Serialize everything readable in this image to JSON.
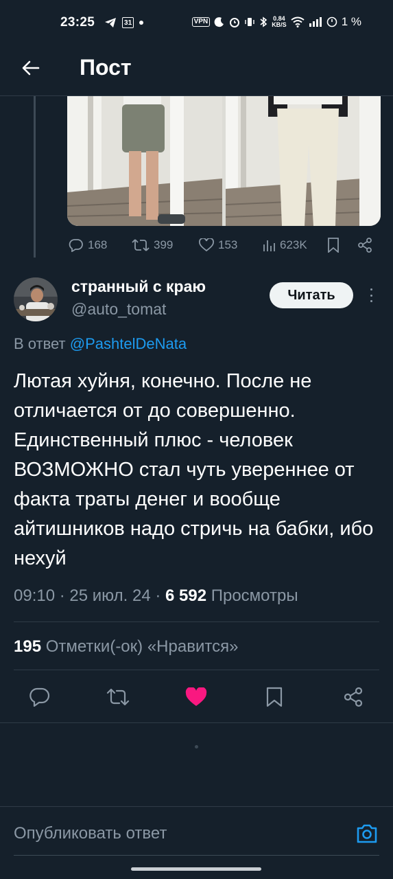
{
  "status_bar": {
    "time": "23:25",
    "calendar_day": "31",
    "vpn": "VPN",
    "net_speed_value": "0.84",
    "net_speed_unit": "KB/S",
    "battery": "1 %"
  },
  "header": {
    "title": "Пост"
  },
  "prev_tweet": {
    "stats": {
      "replies": "168",
      "retweets": "399",
      "likes": "153",
      "views": "623K"
    }
  },
  "tweet": {
    "author_name": "странный с краю",
    "author_handle": "@auto_tomat",
    "follow_label": "Читать",
    "reply_prefix": "В ответ",
    "reply_to": "@PashtelDeNata",
    "text": "Лютая хуйня, конечно. После не отличается от до совершенно. Единственный плюс - человек ВОЗМОЖНО стал чуть увереннее от факта траты денег и вообще айтишников надо стричь на бабки, ибо нехуй",
    "time_date": "09:10 · 25 июл. 24 · ",
    "views_count": "6 592",
    "views_label": " Просмотры",
    "likes_count": "195",
    "likes_label": " Отметки(-ок) «Нравится»"
  },
  "composer": {
    "placeholder": "Опубликовать ответ"
  },
  "colors": {
    "background": "#15202b",
    "accent": "#1d9bf0",
    "like": "#f91880",
    "muted": "#8b98a5"
  }
}
